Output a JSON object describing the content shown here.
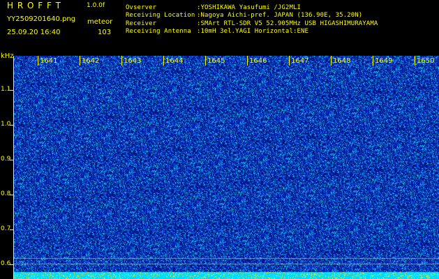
{
  "header": {
    "logo": "H R O F F T",
    "version": "1.0.0f",
    "filename": "YY2509201640.png",
    "datetime": "25.09.20 16:40",
    "mode_label": "meteor",
    "count": "103"
  },
  "info": [
    {
      "key": "Ovserver",
      "value": ":YOSHIKAWA Yasufumi /JG2MLI"
    },
    {
      "key": "Receiving Location",
      "value": ":Nagoya Aichi-pref. JAPAN (136.90E, 35.20N)"
    },
    {
      "key": "Receiver",
      "value": ":SMArt RTL-SDR V5 52.905MHz USB HIGASHIMURAYAMA"
    },
    {
      "key": "Receiving Antenna",
      "value": ":10mH 3el.YAGI Horizontal:ENE"
    }
  ],
  "chart_data": {
    "type": "heatmap",
    "ylabel": "kHz",
    "y_ticks": [
      "1.1",
      "1.0",
      "0.9",
      "0.8",
      "0.7",
      "0.6"
    ],
    "x_ticks": [
      "1641",
      "1642",
      "1643",
      "1644",
      "1645",
      "1646",
      "1647",
      "1648",
      "1649",
      "1650"
    ],
    "ylim": [
      0.58,
      1.2
    ],
    "colors": {
      "background": "#000000",
      "text": "#ffff00",
      "noise_low": "#0a18a8",
      "noise_high": "#00e5ff"
    }
  }
}
